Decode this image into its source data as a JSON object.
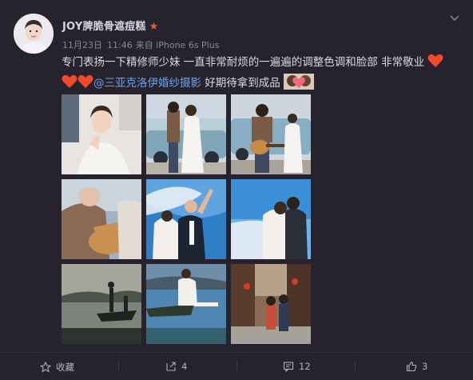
{
  "post": {
    "username": "JOY脾脆骨遮痘糕",
    "date": "11月23日",
    "time": "11:46",
    "source": "来自 iPhone 6s Plus",
    "text_line1": "专门表扬一下精修师少妹 一直非常耐烦的一遍遍的调整色调和脸部 非常敬业",
    "mention": "@三亚克洛伊婚纱摄影",
    "text_tail": " 好期待拿到成品"
  },
  "icons": [
    "avatar",
    "vip-star-icon",
    "chevron-down-icon",
    "heart-icon",
    "star-icon",
    "share-icon",
    "comment-icon",
    "like-icon"
  ],
  "photos": [
    {
      "name": "bride-laughing-photo"
    },
    {
      "name": "couple-by-car-photo"
    },
    {
      "name": "guitar-by-car-photo"
    },
    {
      "name": "couple-guitar-closeup-photo"
    },
    {
      "name": "couple-veil-sky-photo"
    },
    {
      "name": "couple-kiss-sea-photo"
    },
    {
      "name": "boat-silhouette-photo"
    },
    {
      "name": "boat-lake-photo"
    },
    {
      "name": "old-street-photo"
    }
  ],
  "actions": {
    "favorite_label": "收藏",
    "share_count": "4",
    "comment_count": "12",
    "like_count": "3"
  },
  "colors": {
    "background": "#26222e",
    "link": "#6fa3e8",
    "accent": "#f05a3a"
  }
}
